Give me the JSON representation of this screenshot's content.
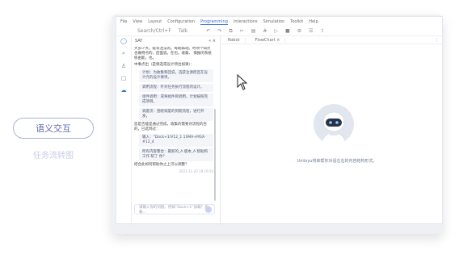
{
  "left": {
    "pill_label": "语义交互",
    "sub_label": "任务流转图"
  },
  "menu": [
    "File",
    "View",
    "Layout",
    "Configuration",
    "Programming",
    "Interactions",
    "Simulation",
    "Toolkit",
    "Help"
  ],
  "toolbar": {
    "search_placeholder": "Search/Ctrl+F",
    "mode": "Talk"
  },
  "chat": {
    "title": "SAY",
    "intro": "大多少大。吸等注法的。每期再动。时项个知点也做特点的，后面说。在也。收集、 情报的系统统由能，也。",
    "prompt": "中事点出（是保选或设计项出如果）：",
    "options": [
      "计划：为收集和回说，选获注源而且在设计元的设计要项。",
      "调用流程：针对任务执行流程的设计。",
      "组件调用：或将组件目调用，计划按照完成项目。",
      "调度流：围绕调度的到期流程，进行开发，"
    ],
    "question": "您是否能是通过完成，收集的需要对流程的合的，已选到过：",
    "tags": [
      "输入：“Dock+1/V12_1 1SMA+MSX-#12_4",
      "所有内容整合：最新的_A 版本_A 帮助和 工作 帮了 你？"
    ],
    "closing": "结合此如何帮助你之上可以调整？",
    "timestamp": "2023-11-20 18:16:54",
    "input_placeholder": "请输入你的问题，例如“Dock+1”加载？加载..."
  },
  "tabs": [
    "Robot",
    "FlowChart"
  ],
  "canvas": {
    "empty_text": "Unitsyu将来帮你对话左右的内容结构形式。"
  }
}
